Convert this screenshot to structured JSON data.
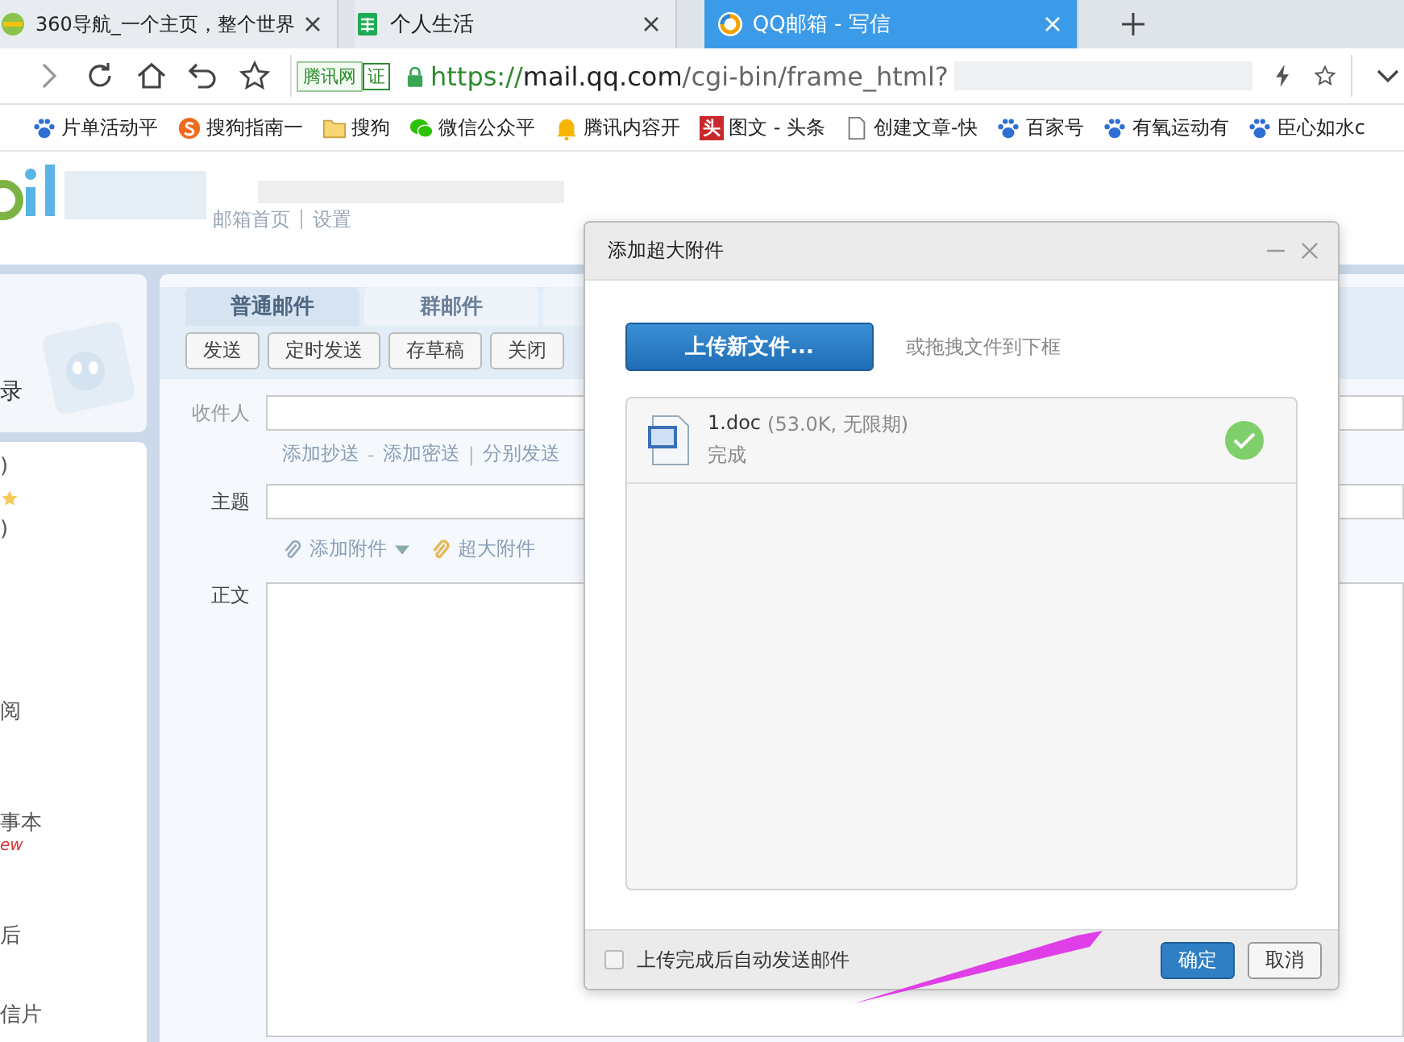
{
  "browser": {
    "tabs": [
      {
        "title": "360导航_一个主页，整个世界",
        "selected": false
      },
      {
        "title": "个人生活",
        "selected": false
      },
      {
        "title": "QQ邮箱 - 写信",
        "selected": true
      }
    ],
    "address_bar": {
      "site_badge": "腾讯网",
      "verified_badge": "证",
      "url_scheme": "https://",
      "url_host": "mail.qq.com",
      "url_path": "/cgi-bin/frame_html?"
    },
    "bookmarks": [
      {
        "label": "片单活动平",
        "kind": "paw"
      },
      {
        "label": "搜狗指南一",
        "kind": "sogou"
      },
      {
        "label": "搜狗",
        "kind": "folder"
      },
      {
        "label": "微信公众平",
        "kind": "wechat"
      },
      {
        "label": "腾讯内容开",
        "kind": "bell"
      },
      {
        "label": "图文 - 头条",
        "kind": "toutiao",
        "icon_text": "头"
      },
      {
        "label": "创建文章-快",
        "kind": "page"
      },
      {
        "label": "百家号",
        "kind": "paw"
      },
      {
        "label": "有氧运动有",
        "kind": "paw"
      },
      {
        "label": "臣心如水c",
        "kind": "paw"
      }
    ]
  },
  "mail": {
    "header_links": [
      {
        "label": "邮箱首页"
      },
      {
        "sep": "|",
        "label": "设置"
      }
    ],
    "sidebar": {
      "title": "录",
      "items": [
        {
          "text": ")",
          "kind": "text"
        },
        {
          "kind": "star"
        },
        {
          "text": ")",
          "kind": "text"
        },
        {
          "text": "阅",
          "kind": "text"
        },
        {
          "text": "事本",
          "kind": "text"
        },
        {
          "text": "ew",
          "kind": "new"
        },
        {
          "text": "后",
          "kind": "text"
        },
        {
          "text": "信片",
          "kind": "text"
        }
      ]
    },
    "compose": {
      "tabs": [
        {
          "label": "普通邮件",
          "selected": true
        },
        {
          "label": "群邮件",
          "selected": false
        }
      ],
      "actions": [
        "发送",
        "定时发送",
        "存草稿",
        "关闭"
      ],
      "recipient_label": "收件人",
      "recipient_links": [
        {
          "label": "添加抄送"
        },
        {
          "sep": "-",
          "label": "添加密送"
        },
        {
          "sep": "|",
          "label": "分别发送"
        }
      ],
      "subject_label": "主题",
      "attach_links": [
        "添加附件",
        "超大附件"
      ],
      "body_label": "正文"
    }
  },
  "dialog": {
    "title": "添加超大附件",
    "upload_button": "上传新文件...",
    "drop_hint": "或拖拽文件到下框",
    "files": [
      {
        "name": "1.doc",
        "meta": "(53.0K, 无限期)",
        "status": "完成",
        "done": true
      }
    ],
    "auto_send": {
      "label": "上传完成后自动发送邮件",
      "checked": false
    },
    "buttons": [
      "确定",
      "取消"
    ]
  }
}
